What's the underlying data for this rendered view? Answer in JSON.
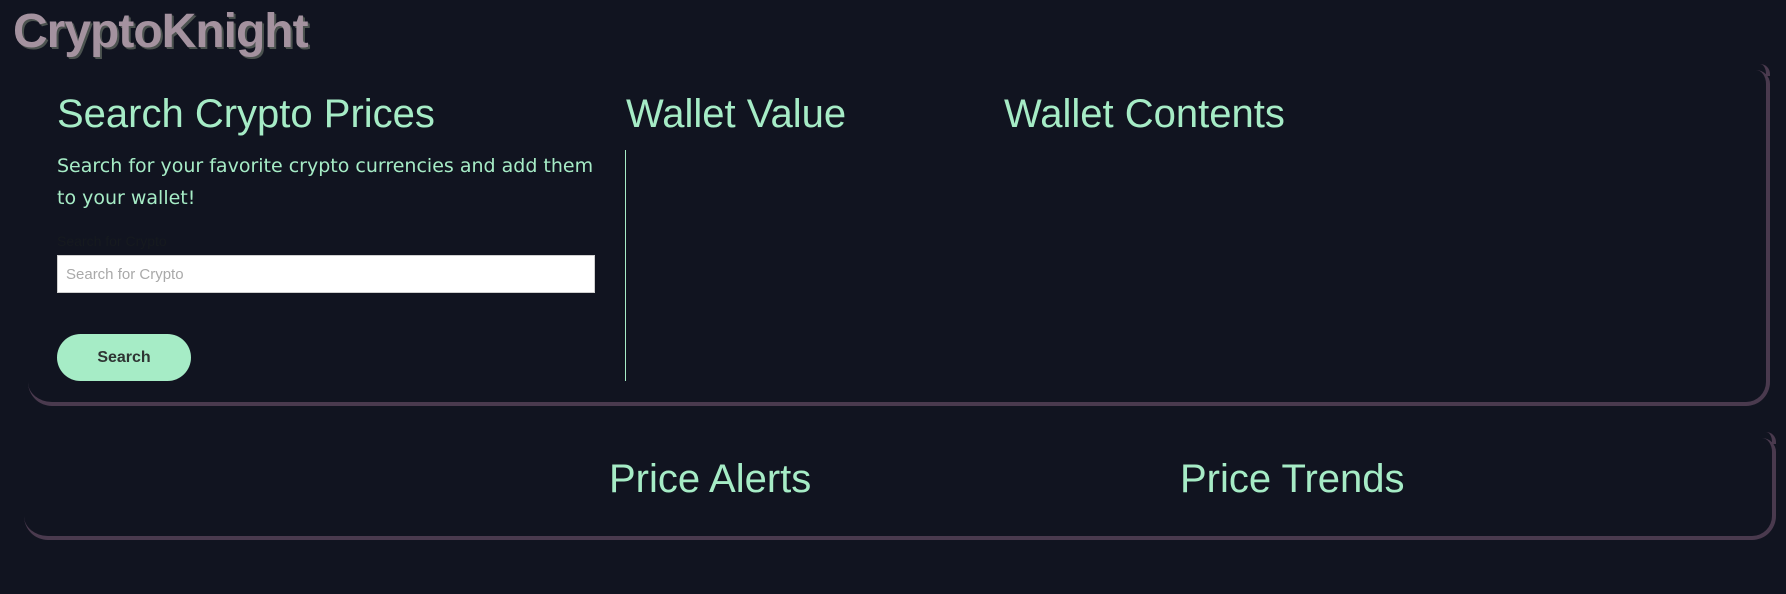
{
  "app": {
    "title": "CryptoKnight"
  },
  "search_panel": {
    "title": "Search Crypto Prices",
    "description": "Search for your favorite crypto currencies and add them to your wallet!",
    "field_label": "Search for Crypto",
    "placeholder": "Search for Crypto",
    "value": "",
    "button_label": "Search"
  },
  "wallet_value": {
    "title": "Wallet Value"
  },
  "wallet_contents": {
    "title": "Wallet Contents"
  },
  "price_alerts": {
    "title": "Price Alerts"
  },
  "price_trends": {
    "title": "Price Trends"
  },
  "colors": {
    "background": "#111420",
    "accent": "#a6ecc6",
    "card_border": "#4a3a4e",
    "brand_text": "#a4929f"
  }
}
